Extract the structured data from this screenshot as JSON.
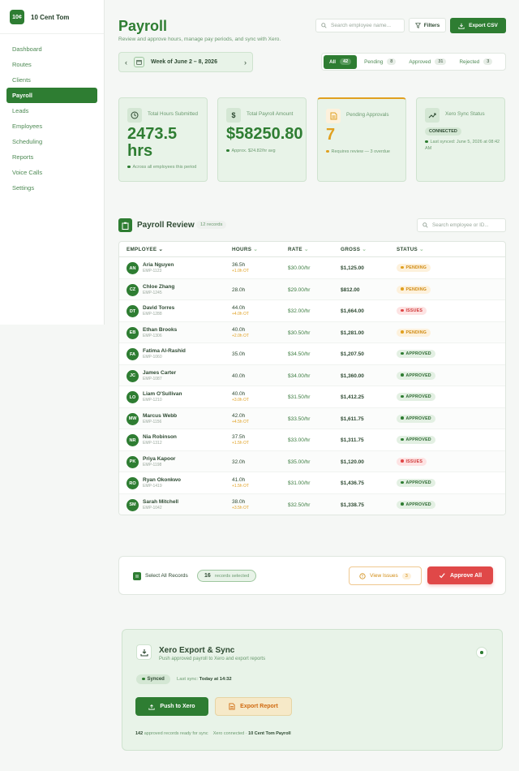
{
  "brand": {
    "logo": "10¢",
    "name": "10 Cent Tom"
  },
  "nav": [
    {
      "label": "Dashboard",
      "active": false
    },
    {
      "label": "Routes",
      "active": false
    },
    {
      "label": "Clients",
      "active": false
    },
    {
      "label": "Payroll",
      "active": true
    },
    {
      "label": "Leads",
      "active": false
    },
    {
      "label": "Employees",
      "active": false
    },
    {
      "label": "Scheduling",
      "active": false
    },
    {
      "label": "Reports",
      "active": false
    },
    {
      "label": "Voice Calls",
      "active": false
    },
    {
      "label": "Settings",
      "active": false
    }
  ],
  "header": {
    "title": "Payroll",
    "subtitle": "Review and approve hours, manage pay periods, and sync with Xero.",
    "search_placeholder": "Search employee name...",
    "filters_label": "Filters",
    "export_label": "Export CSV"
  },
  "week": {
    "label": "Week of June 2 – 8, 2026"
  },
  "tabs": [
    {
      "label": "All",
      "count": "42",
      "active": true
    },
    {
      "label": "Pending",
      "count": "8",
      "active": false
    },
    {
      "label": "Approved",
      "count": "31",
      "active": false
    },
    {
      "label": "Rejected",
      "count": "3",
      "active": false
    }
  ],
  "cards": {
    "hours": {
      "label": "Total Hours Submitted",
      "value": "2473.5 hrs",
      "note": "Across all employees this period"
    },
    "amount": {
      "label": "Total Payroll Amount",
      "value": "$58250.80",
      "note": "Approx. $24.82/hr avg"
    },
    "pending": {
      "label": "Pending Approvals",
      "value": "7",
      "note": "Requires review — 3 overdue"
    },
    "xero": {
      "label": "Xero Sync Status",
      "badge": "CONNECTED",
      "note": "Last synced: June 5, 2026 at 08:42 AM"
    }
  },
  "review": {
    "title": "Payroll Review",
    "count": "12 records",
    "search_placeholder": "Search employee or ID...",
    "columns": {
      "employee": "EMPLOYEE",
      "hours": "HOURS",
      "rate": "RATE",
      "gross": "GROSS",
      "status": "STATUS"
    }
  },
  "rows": [
    {
      "initials": "AN",
      "name": "Aria Nguyen",
      "id": "EMP-1123",
      "hours": "36.5h",
      "ot": "+1.0h OT",
      "rate": "$30.00/hr",
      "gross": "$1,125.00",
      "status": "PENDING",
      "status_class": "pending"
    },
    {
      "initials": "CZ",
      "name": "Chloe Zhang",
      "id": "EMP-1245",
      "hours": "28.0h",
      "ot": "",
      "rate": "$29.00/hr",
      "gross": "$812.00",
      "status": "PENDING",
      "status_class": "pending"
    },
    {
      "initials": "DT",
      "name": "David Torres",
      "id": "EMP-1288",
      "hours": "44.0h",
      "ot": "+4.0h OT",
      "rate": "$32.00/hr",
      "gross": "$1,664.00",
      "status": "ISSUES",
      "status_class": "issues"
    },
    {
      "initials": "EB",
      "name": "Ethan Brooks",
      "id": "EMP-1306",
      "hours": "40.0h",
      "ot": "+2.0h OT",
      "rate": "$30.50/hr",
      "gross": "$1,281.00",
      "status": "PENDING",
      "status_class": "pending"
    },
    {
      "initials": "FA",
      "name": "Fatima Al-Rashid",
      "id": "EMP-1060",
      "hours": "35.0h",
      "ot": "",
      "rate": "$34.50/hr",
      "gross": "$1,207.50",
      "status": "APPROVED",
      "status_class": "approved"
    },
    {
      "initials": "JC",
      "name": "James Carter",
      "id": "EMP-1087",
      "hours": "40.0h",
      "ot": "",
      "rate": "$34.00/hr",
      "gross": "$1,360.00",
      "status": "APPROVED",
      "status_class": "approved"
    },
    {
      "initials": "LO",
      "name": "Liam O'Sullivan",
      "id": "EMP-1210",
      "hours": "40.0h",
      "ot": "+3.0h OT",
      "rate": "$31.50/hr",
      "gross": "$1,412.25",
      "status": "APPROVED",
      "status_class": "approved"
    },
    {
      "initials": "MW",
      "name": "Marcus Webb",
      "id": "EMP-1156",
      "hours": "42.0h",
      "ot": "+4.5h OT",
      "rate": "$33.50/hr",
      "gross": "$1,611.75",
      "status": "APPROVED",
      "status_class": "approved"
    },
    {
      "initials": "NR",
      "name": "Nia Robinson",
      "id": "EMP-1312",
      "hours": "37.5h",
      "ot": "+1.5h OT",
      "rate": "$33.00/hr",
      "gross": "$1,311.75",
      "status": "APPROVED",
      "status_class": "approved"
    },
    {
      "initials": "PK",
      "name": "Priya Kapoor",
      "id": "EMP-1198",
      "hours": "32.0h",
      "ot": "",
      "rate": "$35.00/hr",
      "gross": "$1,120.00",
      "status": "ISSUES",
      "status_class": "issues"
    },
    {
      "initials": "RO",
      "name": "Ryan Okonkwo",
      "id": "EMP-1419",
      "hours": "41.0h",
      "ot": "+1.5h OT",
      "rate": "$31.00/hr",
      "gross": "$1,436.75",
      "status": "APPROVED",
      "status_class": "approved"
    },
    {
      "initials": "SM",
      "name": "Sarah Mitchell",
      "id": "EMP-1042",
      "hours": "38.0h",
      "ot": "+3.5h OT",
      "rate": "$32.50/hr",
      "gross": "$1,338.75",
      "status": "APPROVED",
      "status_class": "approved"
    }
  ],
  "actions": {
    "select_all": "Select All Records",
    "selected_count": "16",
    "selected_text": "records selected",
    "view_issues": "View Issues",
    "issues_count": "3",
    "approve_all": "Approve All"
  },
  "xero": {
    "title": "Xero Export & Sync",
    "subtitle": "Push approved payroll to Xero and export reports",
    "synced": "Synced",
    "last_sync_label": "Last sync:",
    "last_sync_value": "Today at 14:32",
    "push_label": "Push to Xero",
    "report_label": "Export Report",
    "footer_count": "142",
    "footer_text": "approved records ready for sync",
    "footer_connected": "Xero connected ·",
    "footer_org": "10 Cent Tom Payroll"
  },
  "colors": {
    "brand": "#2e7d32",
    "pending": "#e0a020",
    "issues": "#e04848",
    "background": "#f5f7f5"
  }
}
